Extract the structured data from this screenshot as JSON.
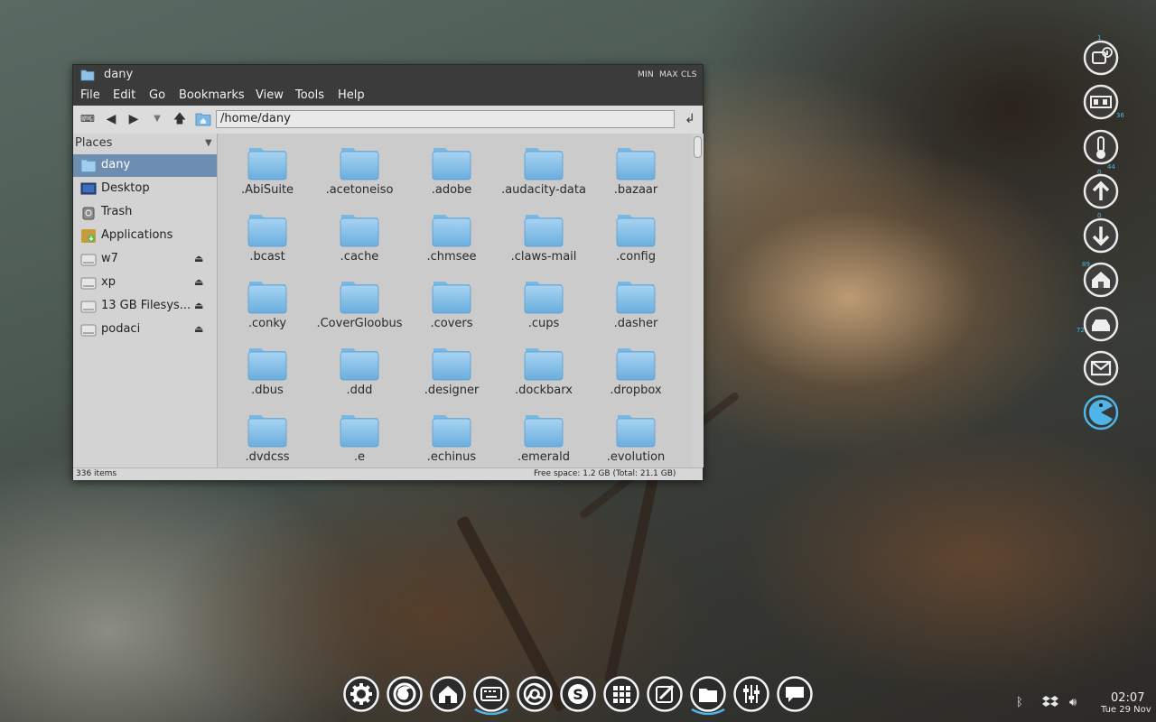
{
  "window": {
    "title": "dany",
    "btn_min": "MIN",
    "btn_max": "MAX",
    "btn_close": "CLS",
    "menus": [
      "File",
      "Edit",
      "Go",
      "Bookmarks",
      "View",
      "Tools",
      "Help"
    ],
    "address": "/home/dany",
    "places_header": "Places",
    "places": [
      {
        "label": "dany",
        "icon": "home-folder-icon",
        "selected": true
      },
      {
        "label": "Desktop",
        "icon": "desktop-icon"
      },
      {
        "label": "Trash",
        "icon": "trash-icon"
      },
      {
        "label": "Applications",
        "icon": "applications-icon"
      },
      {
        "label": "w7",
        "icon": "drive-icon",
        "eject": true
      },
      {
        "label": "xp",
        "icon": "drive-icon",
        "eject": true
      },
      {
        "label": "13 GB Filesys...",
        "icon": "drive-icon",
        "eject": true
      },
      {
        "label": "podaci",
        "icon": "drive-icon",
        "eject": true
      }
    ],
    "files": [
      ".AbiSuite",
      ".acetoneiso",
      ".adobe",
      ".audacity-data",
      ".bazaar",
      ".bcast",
      ".cache",
      ".chmsee",
      ".claws-mail",
      ".config",
      ".conky",
      ".CoverGloobus",
      ".covers",
      ".cups",
      ".dasher",
      ".dbus",
      ".ddd",
      ".designer",
      ".dockbarx",
      ".dropbox",
      ".dvdcss",
      ".e",
      ".echinus",
      ".emerald",
      ".evolution"
    ],
    "status_items": "336 items",
    "status_free": "Free space: 1.2 GB (Total: 21.1 GB)"
  },
  "conky": {
    "numbers": [
      "1",
      "36",
      "44",
      "0",
      "0",
      "89",
      "72"
    ],
    "icons": [
      "system-info-icon",
      "memory-icon",
      "temperature-icon",
      "upload-icon",
      "download-icon",
      "home-disk-icon",
      "drive-disk-icon",
      "mail-icon",
      "pacman-icon"
    ],
    "ring_color": "#4fb4e8"
  },
  "dock": {
    "icons": [
      "settings-gear-icon",
      "firefox-icon",
      "home-icon",
      "keyboard-icon",
      "chromium-icon",
      "skype-icon",
      "apps-grid-icon",
      "editor-icon",
      "files-icon",
      "mixer-icon",
      "chat-icon"
    ]
  },
  "tray": {
    "time": "02:07",
    "date": "Tue 29 Nov"
  }
}
